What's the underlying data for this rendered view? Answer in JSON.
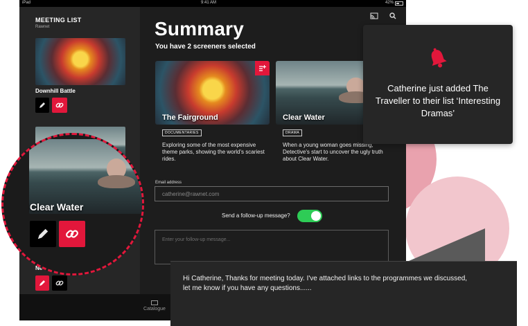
{
  "status_bar": {
    "device": "iPad",
    "time": "9:41 AM",
    "battery": "42%"
  },
  "sidebar": {
    "title": "MEETING LIST",
    "subtitle": "Rawnet",
    "items": [
      {
        "label": "Downhill Battle"
      },
      {
        "label": "Clear Water"
      },
      {
        "label": "Ne"
      }
    ]
  },
  "main": {
    "title": "Summary",
    "subtitle": "You have 2 screeners selected",
    "cards": [
      {
        "title": "The Fairground",
        "genre": "DOCUMENTARIES",
        "description": "Exploring some of the most expensive theme parks, showing the world's scariest rides."
      },
      {
        "title": "Clear Water",
        "genre": "DRAMA",
        "description": "When a young woman goes missing, Detective's start to uncover the ugly truth about Clear Water."
      }
    ],
    "email_label": "Email address",
    "email_placeholder": "catherine@rawnet.com",
    "followup_label": "Send a follow-up message?",
    "followup_enabled": true,
    "message_placeholder": "Enter your follow-up message..."
  },
  "tabbar": {
    "catalogue_label": "Catalogue"
  },
  "notification": {
    "text": "Catherine just added The Traveller to their list ‘Interesting Dramas’"
  },
  "message_popup": {
    "text": "Hi Catherine, Thanks for meeting today. I've attached links to the programmes we discussed, let me know if you have any questions......"
  },
  "lens": {
    "label": "Clear Water"
  },
  "colors": {
    "accent": "#e2173b",
    "toggle_on": "#2ecc56",
    "background": "#1d1d1d",
    "sidebar": "#262626"
  },
  "icons": [
    "cast-icon",
    "search-icon",
    "pencil-icon",
    "link-icon",
    "add-to-list-icon",
    "bell-icon",
    "catalogue-icon"
  ]
}
